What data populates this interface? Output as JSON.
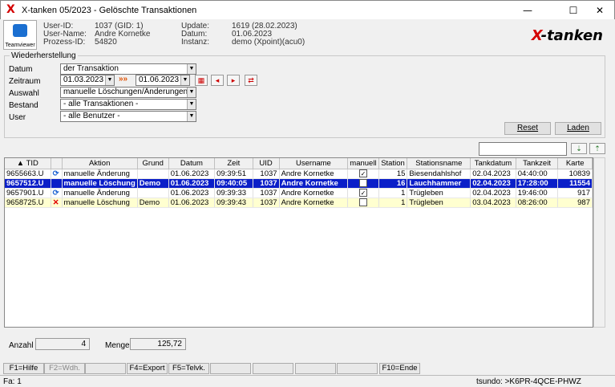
{
  "window": {
    "title": "X-tanken 05/2023 - Gelöschte Transaktionen",
    "app_icon": "X",
    "minimize": "—",
    "maximize": "☐",
    "close": "✕"
  },
  "info": {
    "teamviewer_label": "Teamviewer",
    "userid_label": "User-ID:",
    "userid_value": "1037 (GID: 1)",
    "username_label": "User-Name:",
    "username_value": "Andre Kornetke",
    "prozess_label": "Prozess-ID:",
    "prozess_value": "54820",
    "update_label": "Update:",
    "update_value": "1619 (28.02.2023)",
    "datum_label": "Datum:",
    "datum_value": "01.06.2023",
    "instanz_label": "Instanz:",
    "instanz_value": "demo (Xpoint)(acu0)",
    "brand_x": "X",
    "brand_rest": "-tanken"
  },
  "filter": {
    "legend": "Wiederherstellung",
    "datum_label": "Datum",
    "datum_value": "der Transaktion",
    "zeitraum_label": "Zeitraum",
    "from": "01.03.2023",
    "to": "01.06.2023",
    "auswahl_label": "Auswahl",
    "auswahl_value": "manuelle Löschungen/Änderungen",
    "bestand_label": "Bestand",
    "bestand_value": "- alle Transaktionen -",
    "user_label": "User",
    "user_value": "- alle Benutzer -",
    "reset": "Reset",
    "laden": "Laden"
  },
  "table": {
    "columns": [
      "▲ TID",
      "",
      "Aktion",
      "Grund",
      "Datum",
      "Zeit",
      "UID",
      "Username",
      "manuell",
      "Station",
      "Stationsname",
      "Tankdatum",
      "Tankzeit",
      "Karte"
    ],
    "rows": [
      {
        "tid": "9655663.U",
        "icon": "refresh",
        "aktion": "manuelle Änderung",
        "grund": "",
        "datum": "01.06.2023",
        "zeit": "09:39:51",
        "uid": "1037",
        "user": "Andre Kornetke",
        "manuell": true,
        "station": "15",
        "sname": "Biesendahlshof",
        "tdatum": "02.04.2023",
        "tzeit": "04:40:00",
        "karte": "10839"
      },
      {
        "tid": "9657512.U",
        "icon": "none",
        "aktion": "manuelle Löschung",
        "grund": "Demo",
        "datum": "01.06.2023",
        "zeit": "09:40:05",
        "uid": "1037",
        "user": "Andre Kornetke",
        "manuell": false,
        "station": "16",
        "sname": "Lauchhammer",
        "tdatum": "02.04.2023",
        "tzeit": "17:28:00",
        "karte": "11554"
      },
      {
        "tid": "9657901.U",
        "icon": "refresh",
        "aktion": "manuelle Änderung",
        "grund": "",
        "datum": "01.06.2023",
        "zeit": "09:39:33",
        "uid": "1037",
        "user": "Andre Kornetke",
        "manuell": true,
        "station": "1",
        "sname": "Trügleben",
        "tdatum": "02.04.2023",
        "tzeit": "19:46:00",
        "karte": "917"
      },
      {
        "tid": "9658725.U",
        "icon": "delete",
        "aktion": "manuelle Löschung",
        "grund": "Demo",
        "datum": "01.06.2023",
        "zeit": "09:39:43",
        "uid": "1037",
        "user": "Andre Kornetke",
        "manuell": false,
        "station": "1",
        "sname": "Trügleben",
        "tdatum": "03.04.2023",
        "tzeit": "08:26:00",
        "karte": "987"
      }
    ]
  },
  "summary": {
    "anzahl_label": "Anzahl",
    "anzahl_value": "4",
    "menge_label": "Menge",
    "menge_value": "125,72"
  },
  "fkeys": [
    "F1=Hilfe",
    "F2=Wdh.",
    "",
    "F4=Export",
    "F5=Telvk.",
    "",
    "",
    "",
    "",
    "F10=Ende"
  ],
  "status": {
    "left": "Fa: 1",
    "right": "tsundo: >K6PR-4QCE-PHWZ"
  }
}
